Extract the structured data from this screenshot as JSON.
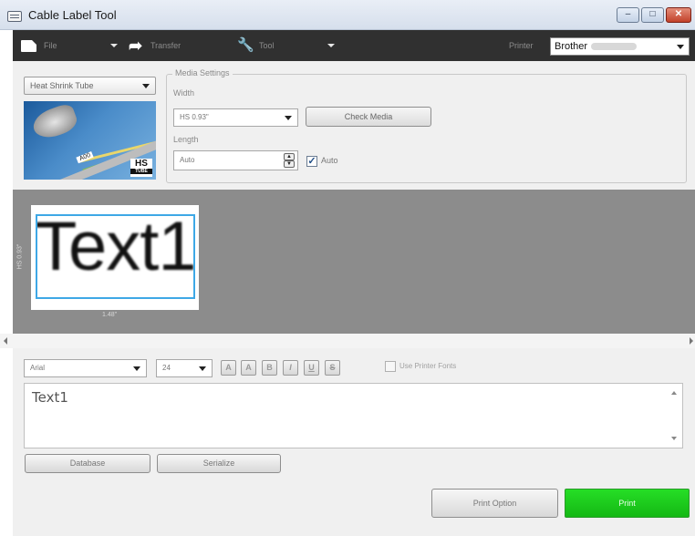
{
  "window": {
    "title": "Cable Label Tool",
    "min_glyph": "–",
    "max_glyph": "□",
    "close_glyph": "✕"
  },
  "toolbar": {
    "file_label": "File",
    "transfer_label": "Transfer",
    "tool_label": "Tool",
    "printer_label": "Printer",
    "printer_value": "Brother"
  },
  "media": {
    "type_value": "Heat Shrink Tube",
    "thumbnail_label": "A00",
    "logo_text": "HS",
    "logo_sub": "TUBE",
    "settings_title": "Media Settings",
    "width_label": "Width",
    "width_value": "HS 0.93\"",
    "check_media_label": "Check Media",
    "length_label": "Length",
    "length_value": "Auto",
    "auto_checked": true,
    "auto_label": "Auto"
  },
  "preview": {
    "label_text": "Text1",
    "width_dim": "1.48\"",
    "height_dim": "HS 0.93\""
  },
  "format": {
    "font_value": "Arial",
    "size_value": "24",
    "buttons": [
      "A",
      "A",
      "B",
      "I",
      "U",
      "S"
    ],
    "use_printer_fonts_label": "Use Printer Fonts",
    "use_printer_fonts_checked": false
  },
  "editor": {
    "text": "Text1"
  },
  "actions": {
    "database_label": "Database",
    "serialize_label": "Serialize",
    "print_option_label": "Print Option",
    "print_label": "Print"
  },
  "colors": {
    "toolbar_bg": "#303030",
    "preview_bg": "#8c8c8c",
    "selection_border": "#3ea8e6",
    "print_button": "#1fca1f"
  }
}
